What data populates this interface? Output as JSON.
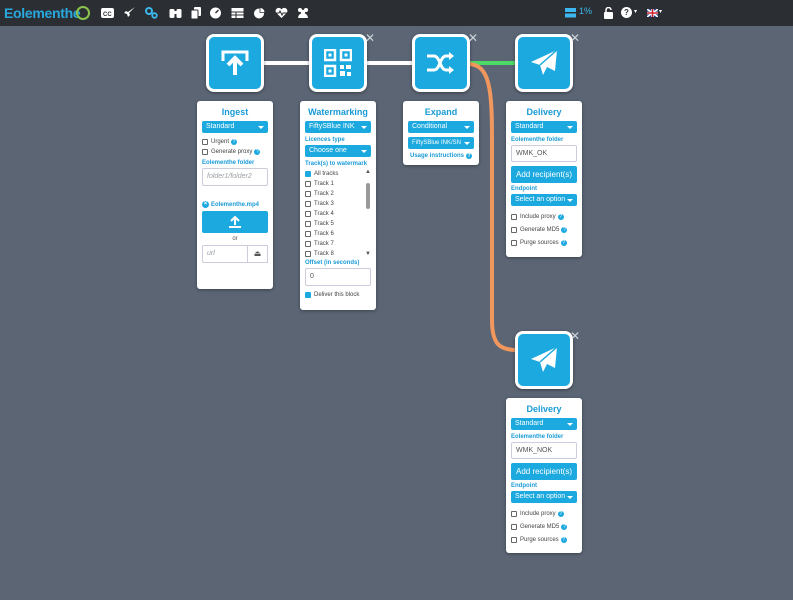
{
  "app": {
    "logo_text": "Eolementhe"
  },
  "toolbar": {
    "icons": [
      "cc-icon",
      "rocket-icon",
      "gears-icon",
      "binoculars-icon",
      "copy-icon",
      "dashboard-icon",
      "table-icon",
      "pie-chart-icon",
      "heartbeat-icon",
      "users-icon"
    ],
    "storage_percent": "1%",
    "help_label": "?",
    "language": "en-GB"
  },
  "nodes": {
    "ingest": {
      "title": "Ingest",
      "mode": "Standard",
      "urgent_label": "Urgent",
      "proxy_label": "Generate proxy",
      "folder_label": "Eolementhe folder",
      "folder_placeholder": "folder1/folder2",
      "file_name": "Eolementhe.mp4",
      "or_label": "or",
      "url_placeholder": "url"
    },
    "watermarking": {
      "title": "Watermarking",
      "mode": "FiftySBlue INK",
      "licences_label": "Licences type",
      "licences_value": "Choose one",
      "tracks_label": "Track(s) to watermark",
      "tracks": [
        "All tracks",
        "Track 1",
        "Track 2",
        "Track 3",
        "Track 4",
        "Track 5",
        "Track 6",
        "Track 7",
        "Track 8"
      ],
      "offset_label": "Offset (in seconds)",
      "offset_value": "0",
      "deliver_label": "Deliver this block"
    },
    "expand": {
      "title": "Expand",
      "mode": "Conditional",
      "condition": "FiftySBlue INK/SN",
      "usage_label": "Usage instructions"
    },
    "delivery_ok": {
      "title": "Delivery",
      "mode": "Standard",
      "folder_label": "Eolementhe folder",
      "folder_value": "WMK_OK",
      "add_label": "Add recipient(s)",
      "endpoint_label": "Endpoint",
      "endpoint_value": "Select an option",
      "proxy_label": "Include proxy",
      "md5_label": "Generate MD5",
      "purge_label": "Purge sources"
    },
    "delivery_nok": {
      "title": "Delivery",
      "mode": "Standard",
      "folder_label": "Eolementhe folder",
      "folder_value": "WMK_NOK",
      "add_label": "Add recipient(s)",
      "endpoint_label": "Endpoint",
      "endpoint_value": "Select an option",
      "proxy_label": "Include proxy",
      "md5_label": "Generate MD5",
      "purge_label": "Purge sources"
    }
  },
  "colors": {
    "accent": "#1ba9df",
    "link_default": "#ffffff",
    "link_true": "#4cd964",
    "link_false": "#f0975e",
    "background": "#5b6574",
    "topbar": "#2b2f33"
  }
}
